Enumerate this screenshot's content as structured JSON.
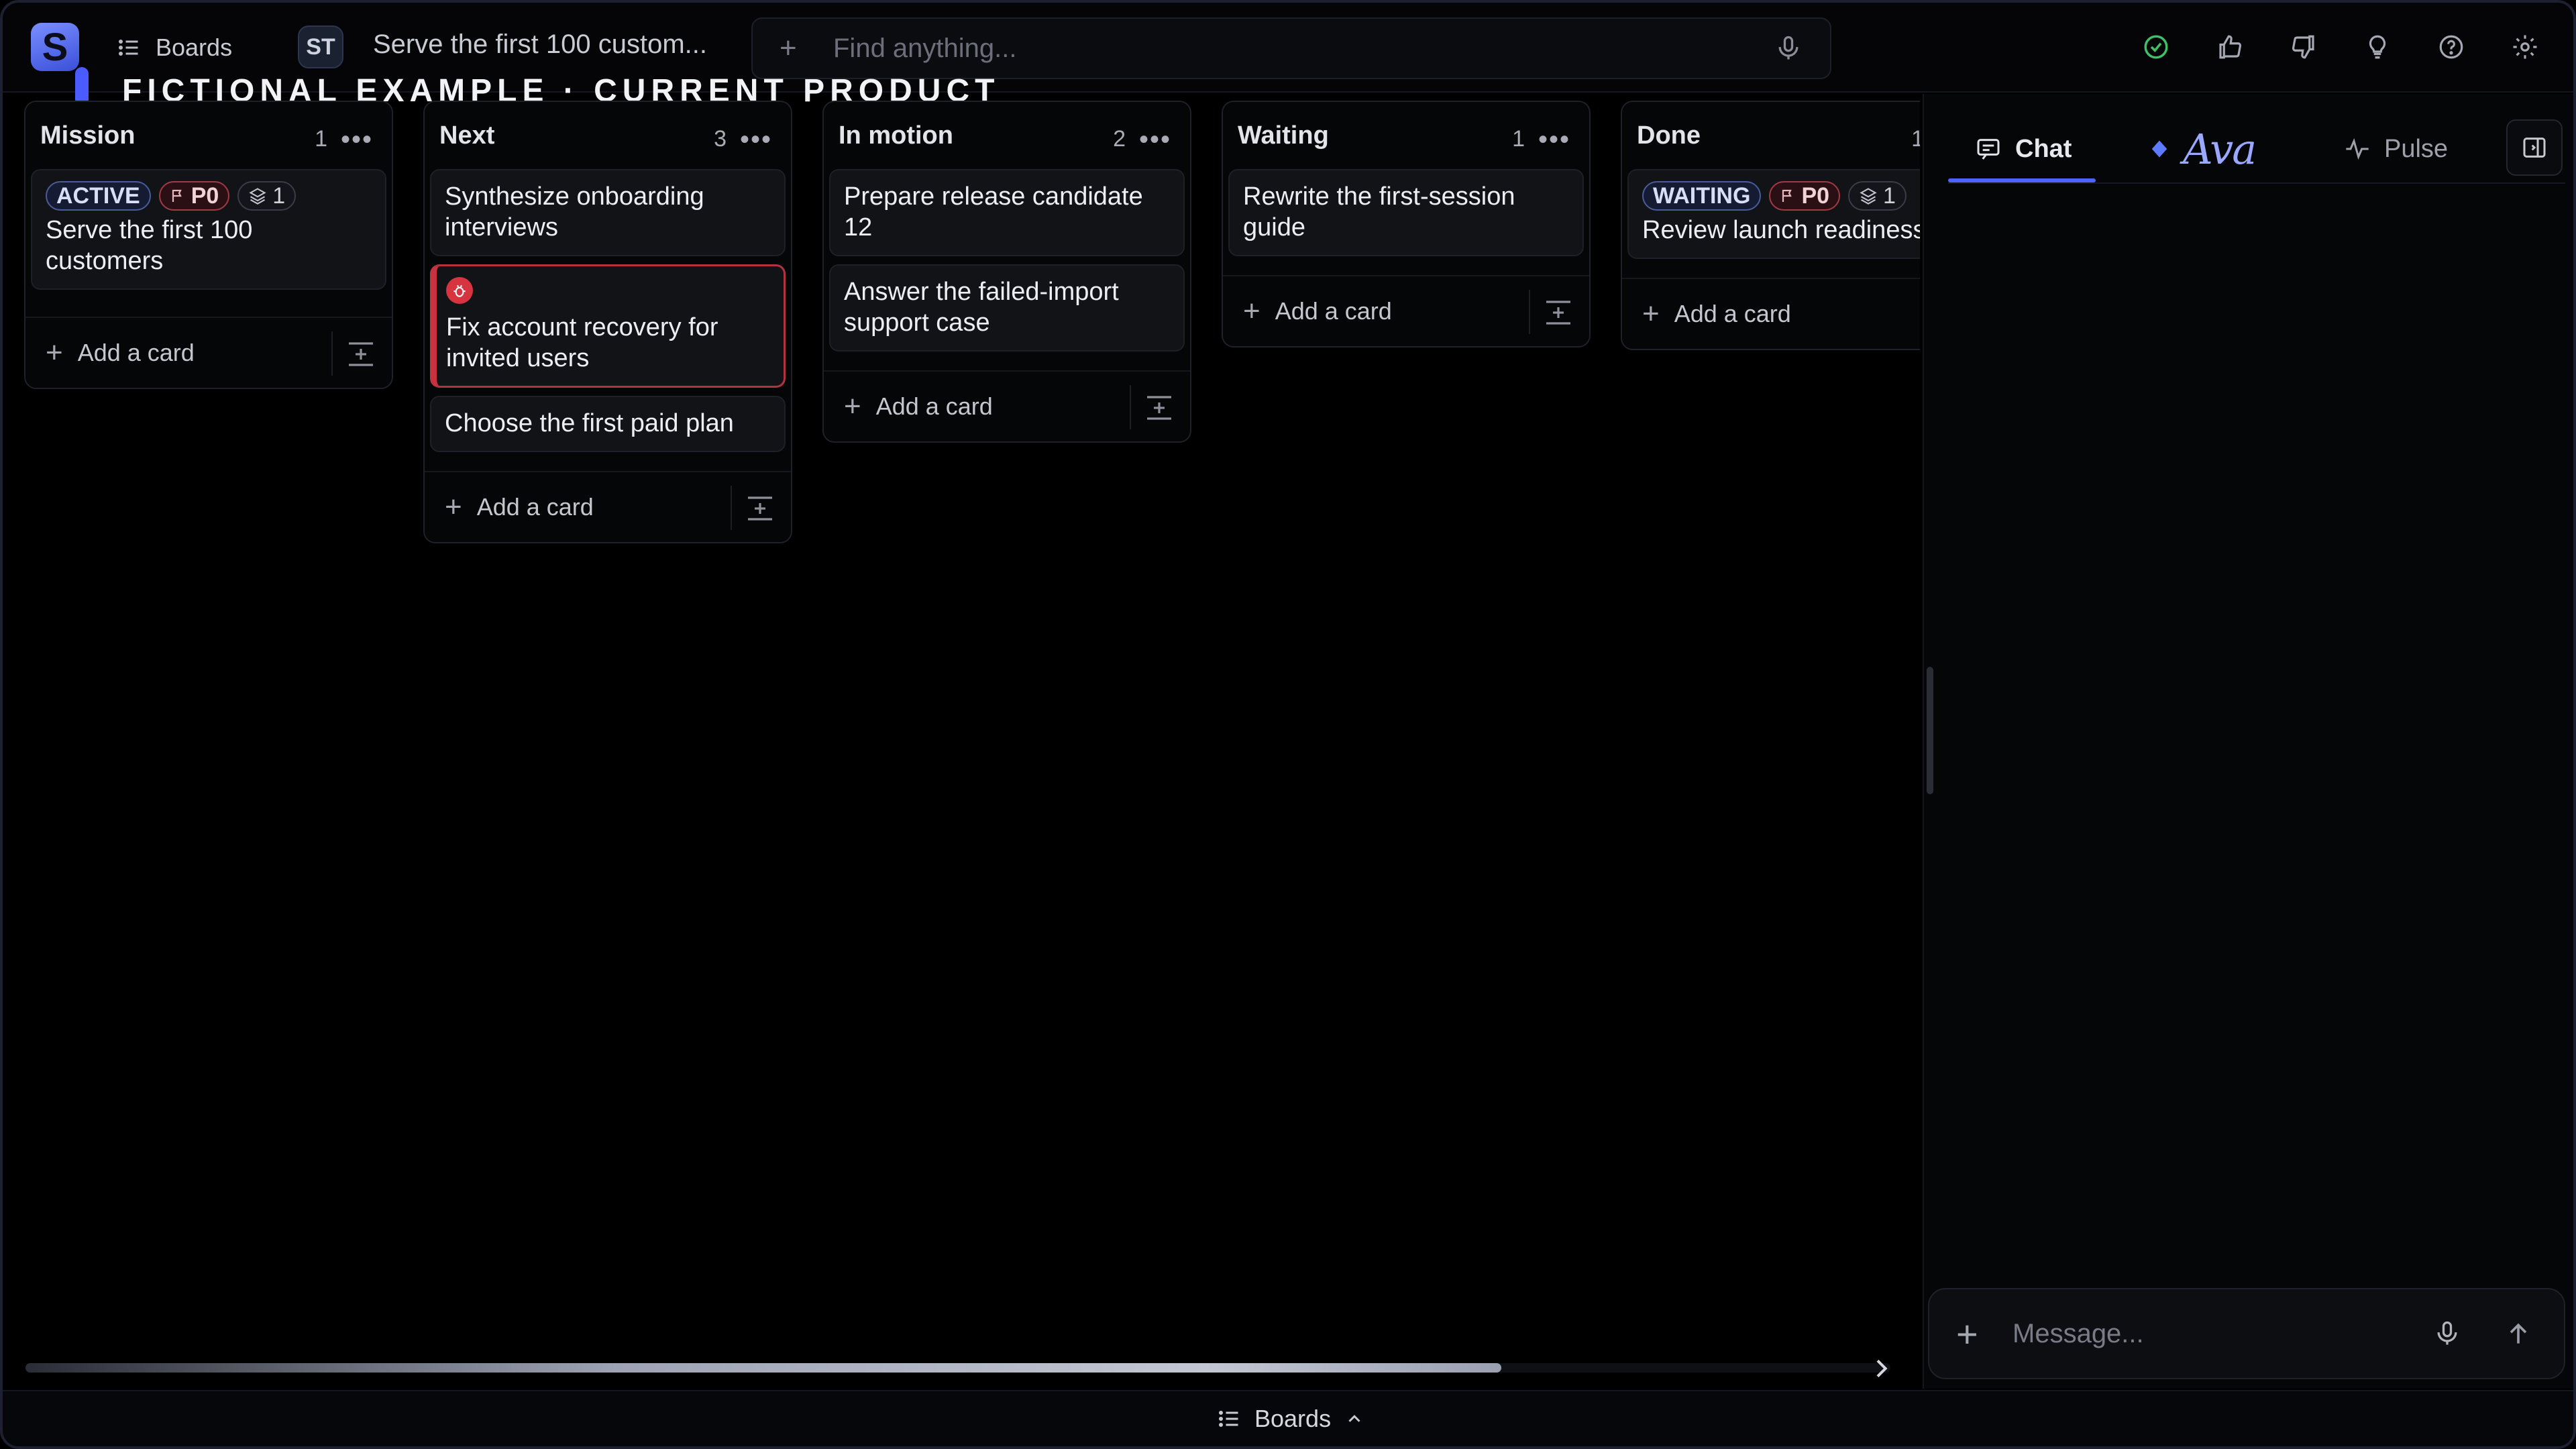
{
  "topbar": {
    "logo_letter": "S",
    "boards_label": "Boards",
    "project_badge": "ST",
    "breadcrumb_title": "Serve the first 100 custom...",
    "search_placeholder": "Find anything...",
    "watermark": "FICTIONAL EXAMPLE · CURRENT PRODUCT",
    "icons": [
      "check-circle-icon",
      "thumbs-up-icon",
      "thumbs-down-icon",
      "lightbulb-icon",
      "help-icon",
      "gear-icon"
    ]
  },
  "board": {
    "add_card_label": "Add a card",
    "columns": [
      {
        "title": "Mission",
        "count": "1",
        "cards": [
          {
            "status": "ACTIVE",
            "priority": "P0",
            "layers": "1",
            "title": "Serve the first 100 customers"
          }
        ]
      },
      {
        "title": "Next",
        "count": "3",
        "cards": [
          {
            "title": "Synthesize onboarding interviews"
          },
          {
            "title": "Fix account recovery for invited users",
            "bug": true
          },
          {
            "title": "Choose the first paid plan"
          }
        ]
      },
      {
        "title": "In motion",
        "count": "2",
        "cards": [
          {
            "title": "Prepare release candidate 12"
          },
          {
            "title": "Answer the failed-import support case"
          }
        ]
      },
      {
        "title": "Waiting",
        "count": "1",
        "cards": [
          {
            "title": "Rewrite the first-session guide"
          }
        ]
      },
      {
        "title": "Done",
        "count": "1",
        "cards": [
          {
            "status": "WAITING",
            "priority": "P0",
            "layers": "1",
            "title": "Review launch readiness"
          }
        ]
      }
    ]
  },
  "panel": {
    "tabs": [
      {
        "label": "Chat",
        "icon": "chat-icon",
        "active": true
      },
      {
        "label": "Ava",
        "icon": "diamond-icon",
        "active": false
      },
      {
        "label": "Pulse",
        "icon": "pulse-icon",
        "active": false
      }
    ],
    "message_placeholder": "Message..."
  },
  "bottombar": {
    "label": "Boards"
  },
  "colors": {
    "accent": "#4b63ff",
    "alert": "#c8323f",
    "success": "#3fbf6a"
  }
}
